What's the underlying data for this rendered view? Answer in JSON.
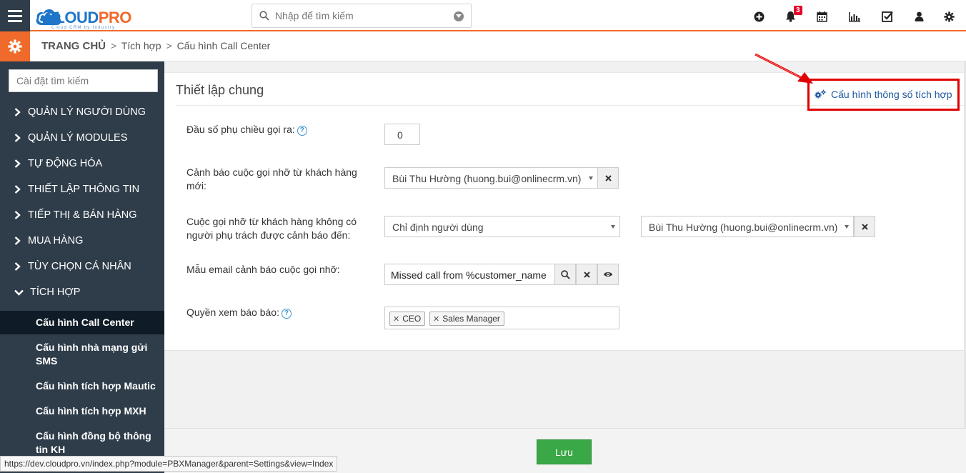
{
  "header": {
    "logo_word_a": "CLOUD",
    "logo_word_b": "PRO",
    "logo_tagline": "Cloud CRM by Industry",
    "search_placeholder": "Nhập để tìm kiếm",
    "notification_count": "3",
    "icons": [
      "plus-circle-icon",
      "bell-icon",
      "calendar-icon",
      "bar-chart-icon",
      "checkbox-icon",
      "user-icon",
      "gear-icon"
    ]
  },
  "breadcrumb": {
    "home": "TRANG CHỦ",
    "sep": ">",
    "level1": "Tích hợp",
    "level2": "Cấu hình Call Center"
  },
  "sidebar": {
    "search_placeholder": "Cài đặt tìm kiếm",
    "items": [
      {
        "label": "QUẢN LÝ NGƯỜI DÙNG"
      },
      {
        "label": "QUẢN LÝ MODULES"
      },
      {
        "label": "TỰ ĐỘNG HÓA"
      },
      {
        "label": "THIẾT LẬP THÔNG TIN"
      },
      {
        "label": "TIẾP THỊ & BÁN HÀNG"
      },
      {
        "label": "MUA HÀNG"
      },
      {
        "label": "TÙY CHỌN CÁ NHÂN"
      },
      {
        "label": "TÍCH HỢP"
      }
    ],
    "sub_items": [
      {
        "label": "Cấu hình Call Center",
        "active": true
      },
      {
        "label": "Cấu hình nhà mạng gửi SMS"
      },
      {
        "label": "Cấu hình tích hợp Mautic"
      },
      {
        "label": "Cấu hình tích hợp MXH"
      },
      {
        "label": "Cấu hình đồng bộ thông tin KH"
      }
    ]
  },
  "panel": {
    "title": "Thiết lập chung",
    "config_link": "Cấu hình thông số tích hợp",
    "fields": {
      "outbound_prefix": {
        "label": "Đầu số phụ chiều gọi ra:",
        "value": "0"
      },
      "missed_new_customer": {
        "label": "Cảnh báo cuộc gọi nhỡ từ khách hàng mới:",
        "value": "Bùi Thu Hường (huong.bui@onlinecrm.vn)"
      },
      "missed_no_owner": {
        "label": "Cuộc gọi nhỡ từ khách hàng không có người phụ trách được cảnh báo đến:",
        "mode": "Chỉ định người dùng",
        "value": "Bùi Thu Hường (huong.bui@onlinecrm.vn)"
      },
      "missed_email_template": {
        "label": "Mẫu email cảnh báo cuộc gọi nhỡ:",
        "value": "Missed call from %customer_name"
      },
      "report_permission": {
        "label": "Quyền xem báo báo:",
        "tags": [
          "CEO",
          "Sales Manager"
        ]
      }
    }
  },
  "footer": {
    "save_label": "Lưu"
  },
  "status_url": "https://dev.cloudpro.vn/index.php?module=PBXManager&parent=Settings&view=Index",
  "colors": {
    "brand_orange": "#f06a2b",
    "brand_blue": "#1f76c9",
    "sidebar_bg": "#2f3d4a",
    "save_green": "#3aa847",
    "highlight_red": "#e00000"
  }
}
